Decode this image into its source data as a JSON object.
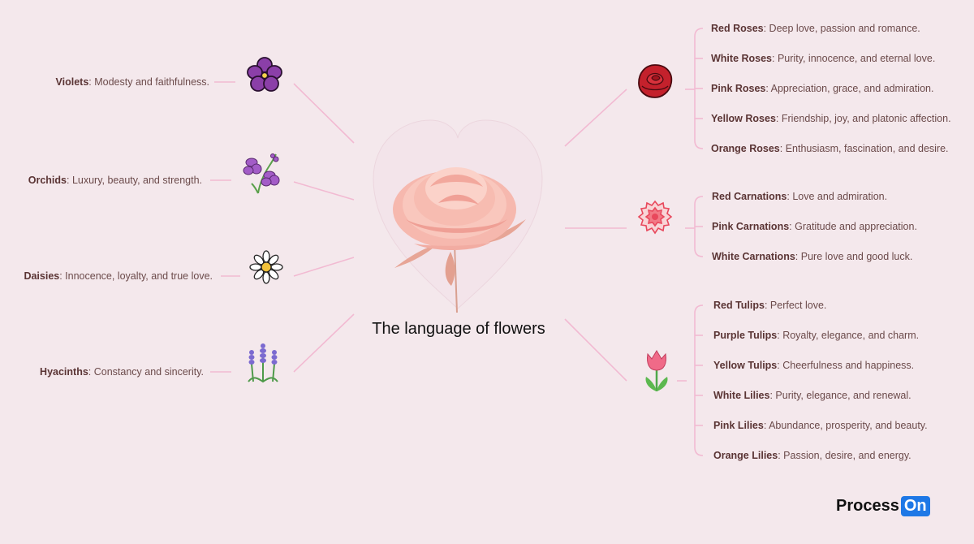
{
  "title": "The language of flowers",
  "logo": {
    "text": "Process",
    "badge": "On"
  },
  "left_branches": [
    {
      "name": "Violets",
      "desc": ": Modesty and faithfulness.",
      "icon": "violet-icon"
    },
    {
      "name": "Orchids",
      "desc": ": Luxury, beauty, and strength.",
      "icon": "orchid-icon"
    },
    {
      "name": "Daisies",
      "desc": ": Innocence, loyalty, and true love.",
      "icon": "daisy-icon"
    },
    {
      "name": "Hyacinths",
      "desc": ": Constancy and sincerity.",
      "icon": "hyacinth-icon"
    }
  ],
  "right_groups": [
    {
      "icon": "rose-icon",
      "items": [
        {
          "name": "Red Roses",
          "desc": ": Deep love, passion and romance."
        },
        {
          "name": "White Roses",
          "desc": ": Purity, innocence, and eternal love."
        },
        {
          "name": "Pink Roses",
          "desc": ": Appreciation, grace, and admiration."
        },
        {
          "name": "Yellow Roses",
          "desc": ": Friendship, joy, and platonic affection."
        },
        {
          "name": "Orange Roses",
          "desc": ": Enthusiasm, fascination, and desire."
        }
      ]
    },
    {
      "icon": "carnation-icon",
      "items": [
        {
          "name": "Red Carnations",
          "desc": ": Love and admiration."
        },
        {
          "name": "Pink Carnations",
          "desc": ": Gratitude and appreciation."
        },
        {
          "name": "White Carnations",
          "desc": ": Pure love and good luck."
        }
      ]
    },
    {
      "icon": "tulip-icon",
      "items": [
        {
          "name": "Red Tulips",
          "desc": ": Perfect love."
        },
        {
          "name": "Purple Tulips",
          "desc": ": Royalty, elegance, and charm."
        },
        {
          "name": "Yellow Tulips",
          "desc": ": Cheerfulness and happiness."
        },
        {
          "name": "White Lilies",
          "desc": ": Purity, elegance, and renewal."
        },
        {
          "name": "Pink Lilies",
          "desc": ": Abundance, prosperity, and beauty."
        },
        {
          "name": "Orange Lilies",
          "desc": ": Passion, desire, and energy."
        }
      ]
    }
  ],
  "colors": {
    "background": "#f4e8ec",
    "connector": "#f0b8d0",
    "label_bold": "#5a3434",
    "label_text": "#6b4a4a",
    "logo_badge": "#1e78e6"
  }
}
